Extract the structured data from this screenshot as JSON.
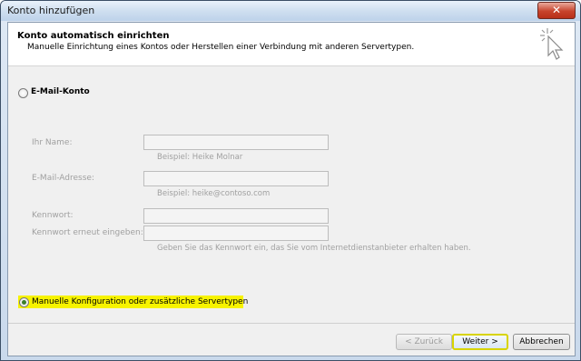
{
  "window": {
    "title": "Konto hinzufügen",
    "close_label": "✕"
  },
  "header": {
    "title": "Konto automatisch einrichten",
    "subtitle": "Manuelle Einrichtung eines Kontos oder Herstellen einer Verbindung mit anderen Servertypen."
  },
  "email_option": {
    "label": "E-Mail-Konto",
    "selected": false
  },
  "form": {
    "name_label": "Ihr Name:",
    "name_value": "",
    "name_hint": "Beispiel: Heike Molnar",
    "email_label": "E-Mail-Adresse:",
    "email_value": "",
    "email_hint": "Beispiel: heike@contoso.com",
    "password_label": "Kennwort:",
    "password_value": "",
    "password_repeat_label": "Kennwort erneut eingeben:",
    "password_repeat_value": "",
    "password_hint": "Geben Sie das Kennwort ein, das Sie vom Internetdienstanbieter erhalten haben."
  },
  "manual_option": {
    "label": "Manuelle Konfiguration oder zusätzliche Servertypen",
    "selected": true
  },
  "buttons": {
    "back": "< Zurück",
    "next": "Weiter >",
    "cancel": "Abbrechen"
  },
  "colors": {
    "highlight": "#f7f300",
    "radio_checked": "#3c7f2a"
  },
  "icons": {
    "wizard": "cursor-sparkle-icon",
    "close": "close-icon"
  }
}
